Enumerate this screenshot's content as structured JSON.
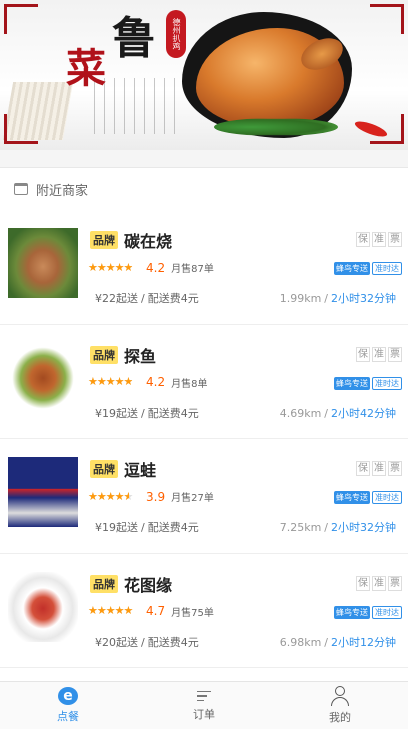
{
  "banner": {
    "title_char_1": "鲁",
    "title_char_2": "菜",
    "seal_text": "德州扒鸡"
  },
  "section": {
    "label": "附近商家"
  },
  "merchants": [
    {
      "brand_tag": "品牌",
      "name": "碳在烧",
      "service_tags": [
        "保",
        "准",
        "票"
      ],
      "rating": 4.2,
      "rating_text": "4.2",
      "sold": "月售87单",
      "badge_delivery": "蜂鸟专送",
      "badge_ontime": "准时达",
      "min_order": "¥22起送",
      "fee_sep": "/",
      "delivery_fee": "配送费4元",
      "distance": "1.99km",
      "time": "2小时32分钟"
    },
    {
      "brand_tag": "品牌",
      "name": "探鱼",
      "service_tags": [
        "保",
        "准",
        "票"
      ],
      "rating": 4.2,
      "rating_text": "4.2",
      "sold": "月售8单",
      "badge_delivery": "蜂鸟专送",
      "badge_ontime": "准时达",
      "min_order": "¥19起送",
      "fee_sep": "/",
      "delivery_fee": "配送费4元",
      "distance": "4.69km",
      "time": "2小时42分钟"
    },
    {
      "brand_tag": "品牌",
      "name": "逗蛙",
      "service_tags": [
        "保",
        "准",
        "票"
      ],
      "rating": 3.9,
      "rating_text": "3.9",
      "sold": "月售27单",
      "badge_delivery": "蜂鸟专送",
      "badge_ontime": "准时达",
      "min_order": "¥19起送",
      "fee_sep": "/",
      "delivery_fee": "配送费4元",
      "distance": "7.25km",
      "time": "2小时32分钟"
    },
    {
      "brand_tag": "品牌",
      "name": "花图缘",
      "service_tags": [
        "保",
        "准",
        "票"
      ],
      "rating": 4.7,
      "rating_text": "4.7",
      "sold": "月售75单",
      "badge_delivery": "蜂鸟专送",
      "badge_ontime": "准时达",
      "min_order": "¥20起送",
      "fee_sep": "/",
      "delivery_fee": "配送费4元",
      "distance": "6.98km",
      "time": "2小时12分钟"
    }
  ],
  "tabbar": {
    "order_food": "点餐",
    "order_food_icon": "e",
    "orders": "订单",
    "profile": "我的"
  },
  "colors": {
    "accent": "#3190e8",
    "rating": "#ff6000",
    "star": "#ff9a0d",
    "brand_tag_bg": "#ffe066"
  }
}
